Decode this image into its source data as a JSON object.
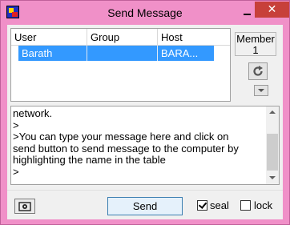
{
  "window": {
    "title": "Send Message",
    "close_label": "✕"
  },
  "table": {
    "columns": [
      "User",
      "Group",
      "Host"
    ],
    "rows": [
      {
        "user": "Barath",
        "group": "",
        "host": "BARA..."
      }
    ]
  },
  "member": {
    "label": "Member",
    "count": "1"
  },
  "message": {
    "lines": [
      "network.",
      ">",
      ">You can type your message here and click on",
      "send button to send message to the computer by",
      "highlighting the name in the table",
      ">"
    ]
  },
  "controls": {
    "send_label": "Send",
    "seal_label": "seal",
    "seal_checked": true,
    "lock_label": "lock",
    "lock_checked": false
  },
  "colors": {
    "title_bar": "#f090c8",
    "close_button": "#c7403a",
    "selection": "#3399ff"
  },
  "icons": [
    "app-icon",
    "minimize-icon",
    "close-icon",
    "refresh-icon",
    "dropdown-arrow-icon",
    "camera-icon"
  ]
}
